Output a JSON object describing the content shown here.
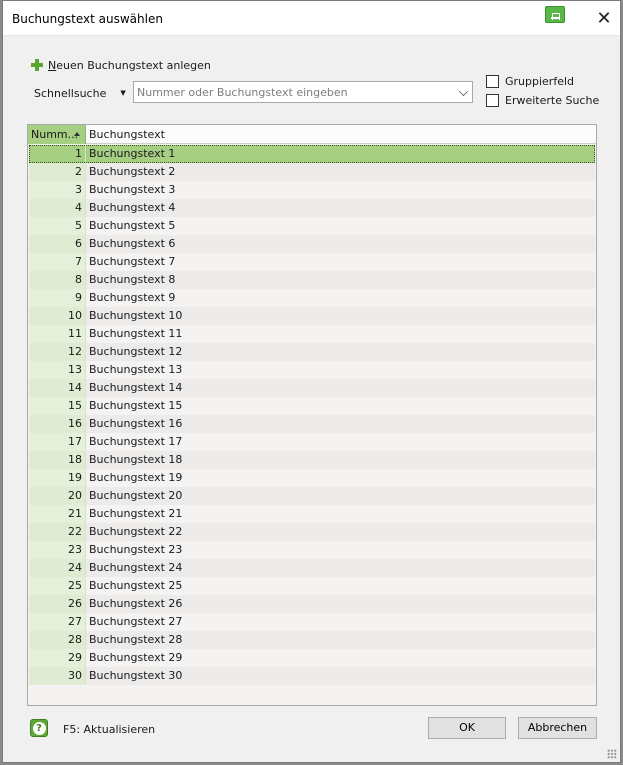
{
  "window": {
    "title": "Buchungstext auswählen",
    "close_glyph": "✕"
  },
  "toolbar": {
    "new_prefix": "N",
    "new_rest": "euen Buchungstext anlegen",
    "search_mode": "Schnellsuche",
    "search_placeholder": "Nummer oder Buchungstext eingeben",
    "search_value": "",
    "group_field_label": "Gruppierfeld",
    "extended_search_label": "Erweiterte Suche"
  },
  "grid": {
    "columns": [
      "Numm...",
      "Buchungstext"
    ],
    "sort_column": "Numm...",
    "selected_row": 0,
    "rows": [
      {
        "num": "1",
        "text": "Buchungstext 1"
      },
      {
        "num": "2",
        "text": "Buchungstext 2"
      },
      {
        "num": "3",
        "text": "Buchungstext 3"
      },
      {
        "num": "4",
        "text": "Buchungstext 4"
      },
      {
        "num": "5",
        "text": "Buchungstext 5"
      },
      {
        "num": "6",
        "text": "Buchungstext 6"
      },
      {
        "num": "7",
        "text": "Buchungstext 7"
      },
      {
        "num": "8",
        "text": "Buchungstext 8"
      },
      {
        "num": "9",
        "text": "Buchungstext 9"
      },
      {
        "num": "10",
        "text": "Buchungstext 10"
      },
      {
        "num": "11",
        "text": "Buchungstext 11"
      },
      {
        "num": "12",
        "text": "Buchungstext 12"
      },
      {
        "num": "13",
        "text": "Buchungstext 13"
      },
      {
        "num": "14",
        "text": "Buchungstext 14"
      },
      {
        "num": "15",
        "text": "Buchungstext 15"
      },
      {
        "num": "16",
        "text": "Buchungstext 16"
      },
      {
        "num": "17",
        "text": "Buchungstext 17"
      },
      {
        "num": "18",
        "text": "Buchungstext 18"
      },
      {
        "num": "19",
        "text": "Buchungstext 19"
      },
      {
        "num": "20",
        "text": "Buchungstext 20"
      },
      {
        "num": "21",
        "text": "Buchungstext 21"
      },
      {
        "num": "22",
        "text": "Buchungstext 22"
      },
      {
        "num": "23",
        "text": "Buchungstext 23"
      },
      {
        "num": "24",
        "text": "Buchungstext 24"
      },
      {
        "num": "25",
        "text": "Buchungstext 25"
      },
      {
        "num": "26",
        "text": "Buchungstext 26"
      },
      {
        "num": "27",
        "text": "Buchungstext 27"
      },
      {
        "num": "28",
        "text": "Buchungstext 28"
      },
      {
        "num": "29",
        "text": "Buchungstext 29"
      },
      {
        "num": "30",
        "text": "Buchungstext 30"
      }
    ]
  },
  "footer": {
    "help_glyph": "?",
    "refresh_hint": "F5: Aktualisieren",
    "ok_label": "OK",
    "cancel_label": "Abbrechen"
  },
  "colors": {
    "accent_green": "#a6cf83",
    "icon_green": "#5fa83a"
  }
}
